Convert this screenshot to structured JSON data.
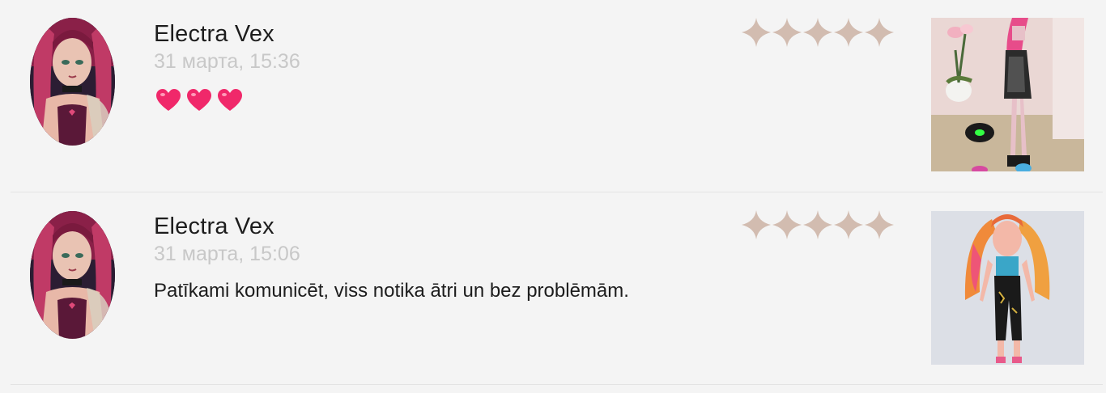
{
  "reviews": [
    {
      "author": "Electra Vex",
      "date": "31 марта, 15:36",
      "text": "",
      "emoji": [
        "heart-emoji",
        "heart-emoji",
        "heart-emoji"
      ],
      "rating": 5
    },
    {
      "author": "Electra Vex",
      "date": "31 марта, 15:06",
      "text": "Patīkami komunicēt, viss notika ātri un bez problēmām.",
      "rating": 5
    }
  ],
  "colors": {
    "star": "#d2bcb0",
    "heart": "#f0286a",
    "name": "#1d1d1d",
    "date": "#c8c8c8"
  }
}
